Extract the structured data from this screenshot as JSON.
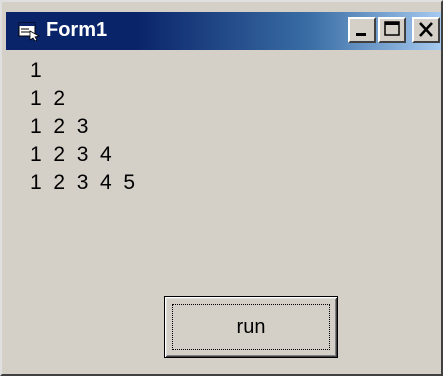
{
  "window": {
    "title": "Form1",
    "controls": {
      "minimize": "minimize-icon",
      "maximize": "maximize-icon",
      "close": "close-icon"
    },
    "icon": "form-app-icon"
  },
  "output": {
    "lines": [
      "1",
      "1  2",
      "1  2  3",
      "1  2  3  4",
      "1  2  3  4  5"
    ]
  },
  "run_button": {
    "label": "run"
  },
  "colors": {
    "face": "#d4d0c8",
    "title_active": "#0a246a",
    "title_gradient_end": "#a6caf0"
  }
}
